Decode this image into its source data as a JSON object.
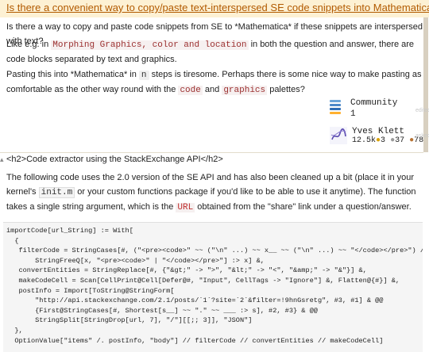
{
  "question": {
    "title": "Is there a convenient way to copy/paste text-interspersed SE code snippets into Mathematica?",
    "p1": "Is there a way to copy and paste code snippets from SE to *Mathematica* if these snippets are interspersed with text?",
    "p2_before": "Like e.g. in ",
    "p2_code": "Morphing Graphics, color and location",
    "p2_after": " in both the question and answer, there are code blocks separated by text and graphics.",
    "p3_a": "Pasting this into *Mathematica* in ",
    "p3_code_n": "n",
    "p3_b": " steps is tiresome. Perhaps there is some nice way to make pasting as comfortable as the other way round with the ",
    "p3_code_code": "code",
    "p3_c": " and ",
    "p3_code_graphics": "graphics",
    "p3_d": " palettes?"
  },
  "community": {
    "name": "Community",
    "count": "1",
    "faded_label": "edited",
    "icon_colors": [
      "#6aa3d8",
      "#4c88c8",
      "#2f6db5",
      "#ffb030"
    ]
  },
  "user": {
    "name": "Yves Klett",
    "rep": "12.5k",
    "gold": "3",
    "silver": "37",
    "bronze": "78",
    "faded_label": "asked"
  },
  "answer": {
    "heading": "<h2>Code extractor using the StackExchange API</h2>",
    "p1_a": "The following code uses the 2.0 version of the SE API and has also been cleaned up a bit (place it in your kernel's ",
    "p1_code": "init.m",
    "p1_b": " or your custom functions package if you'd like to be able to use it anytime). The function takes a single string argument, which is the ",
    "p1_code_url": "URL",
    "p1_c": " obtained from the \"share\" link under a question/answer."
  },
  "code_lines": [
    "importCode[url_String] := With[",
    "  {",
    "   filterCode = StringCases[#, (\"<pre><code>\" ~~ (\"\\n\" ...) ~~ x__ ~~ (\"\\n\" ...) ~~ \"</code></pre>\") /;",
    "       StringFreeQ[x, \"<pre><code>\" | \"</code></pre>\"] :> x] &,",
    "   convertEntities = StringReplace[#, {\"&gt;\" -> \">\", \"&lt;\" -> \"<\", \"&amp;\" -> \"&\"}] &,",
    "   makeCodeCell = Scan[CellPrint@Cell[Defer@#, \"Input\", CellTags -> \"Ignore\"] &, Flatten@{#}] &,",
    "   postInfo = Import[ToString@StringForm[",
    "       \"http://api.stackexchange.com/2.1/posts/`1`?site=`2`&filter=!9hnGsretg\", #3, #1] & @@",
    "       {First@StringCases[#, Shortest[s__] ~~ \".\" ~~ ___ :> s], #2, #3} & @@",
    "       StringSplit[StringDrop[url, 7], \"/\"][[;; 3]], \"JSON\"]",
    "  },",
    "  OptionValue[\"items\" /. postInfo, \"body\"] // filterCode // convertEntities // makeCodeCell]"
  ]
}
